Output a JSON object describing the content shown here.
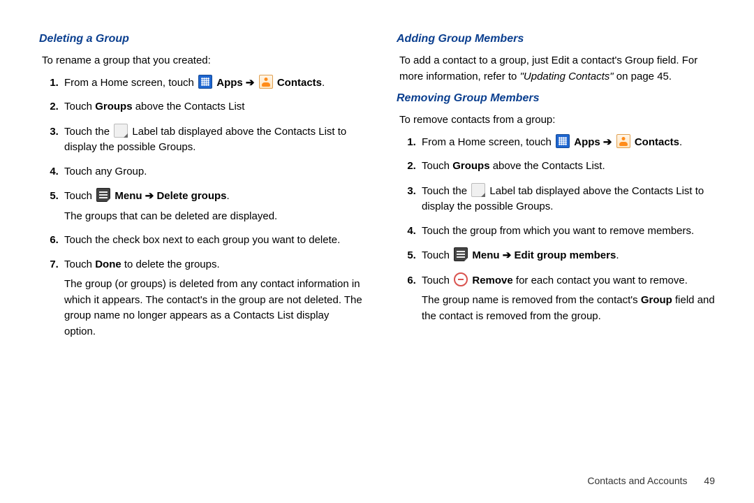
{
  "left": {
    "heading": "Deleting a Group",
    "intro": "To rename a group that you created:",
    "steps": {
      "s1_a": "From a Home screen, touch ",
      "s1_apps": " Apps",
      "s1_arrow": " ➔ ",
      "s1_contacts": " Contacts",
      "s1_end": ".",
      "s2_a": "Touch ",
      "s2_b": "Groups",
      "s2_c": " above the Contacts List",
      "s3_a": "Touch the ",
      "s3_b": " Label tab displayed above the Contacts List to display the possible Groups.",
      "s4": "Touch any Group.",
      "s5_a": "Touch ",
      "s5_menu": " Menu",
      "s5_arrow": " ➔ ",
      "s5_delete": "Delete groups",
      "s5_end": ".",
      "s5_follow": "The groups that can be deleted are displayed.",
      "s6": "Touch the check box next to each group you want to delete.",
      "s7_a": "Touch ",
      "s7_b": "Done",
      "s7_c": " to delete the groups.",
      "s7_follow": "The group (or groups) is deleted from any contact information in which it appears. The contact's in the group are not deleted. The group name no longer appears as a Contacts List display option."
    }
  },
  "right": {
    "heading_add": "Adding Group Members",
    "add_p1": "To add a contact to a group, just Edit a contact's Group field. For more information, refer to ",
    "add_ref": "\"Updating Contacts\"",
    "add_p2": "  on page 45.",
    "heading_remove": "Removing Group Members",
    "remove_intro": "To remove contacts from a group:",
    "steps": {
      "s1_a": "From a Home screen, touch ",
      "s1_apps": " Apps",
      "s1_arrow": " ➔ ",
      "s1_contacts": " Contacts",
      "s1_end": ".",
      "s2_a": "Touch ",
      "s2_b": "Groups",
      "s2_c": " above the Contacts List.",
      "s3_a": "Touch the ",
      "s3_b": " Label tab displayed above the Contacts List to display the possible Groups.",
      "s4": "Touch the group from which you want to remove members.",
      "s5_a": "Touch ",
      "s5_menu": " Menu",
      "s5_arrow": " ➔ ",
      "s5_edit": "Edit group members",
      "s5_end": ".",
      "s6_a": "Touch ",
      "s6_b": " Remove",
      "s6_c": " for each contact you want to remove.",
      "s6_follow_a": "The group name is removed from the contact's ",
      "s6_follow_b": "Group",
      "s6_follow_c": " field and the contact is removed from the group."
    }
  },
  "footer": {
    "section": "Contacts and Accounts",
    "page": "49"
  }
}
